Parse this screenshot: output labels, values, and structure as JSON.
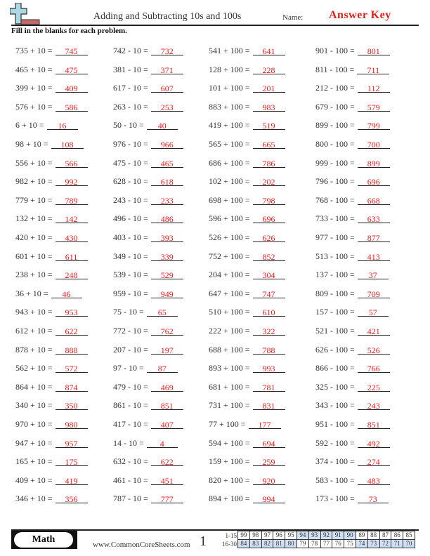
{
  "header": {
    "title": "Adding and Subtracting 10s and 100s",
    "name_label": "Name:",
    "answer_key": "Answer Key",
    "logo_icon": "plus-minus-icon"
  },
  "instructions": "Fill in the blanks for each problem.",
  "columns": [
    {
      "problems": [
        {
          "q": "735 + 10 =",
          "a": "745"
        },
        {
          "q": "465 + 10 =",
          "a": "475"
        },
        {
          "q": "399 + 10 =",
          "a": "409"
        },
        {
          "q": "576 + 10 =",
          "a": "586"
        },
        {
          "q": "6 + 10 =",
          "a": "16"
        },
        {
          "q": "98 + 10 =",
          "a": "108"
        },
        {
          "q": "556 + 10 =",
          "a": "566"
        },
        {
          "q": "982 + 10 =",
          "a": "992"
        },
        {
          "q": "779 + 10 =",
          "a": "789"
        },
        {
          "q": "132 + 10 =",
          "a": "142"
        },
        {
          "q": "420 + 10 =",
          "a": "430"
        },
        {
          "q": "601 + 10 =",
          "a": "611"
        },
        {
          "q": "238 + 10 =",
          "a": "248"
        },
        {
          "q": "36 + 10 =",
          "a": "46"
        },
        {
          "q": "943 + 10 =",
          "a": "953"
        },
        {
          "q": "612 + 10 =",
          "a": "622"
        },
        {
          "q": "878 + 10 =",
          "a": "888"
        },
        {
          "q": "562 + 10 =",
          "a": "572"
        },
        {
          "q": "864 + 10 =",
          "a": "874"
        },
        {
          "q": "340 + 10 =",
          "a": "350"
        },
        {
          "q": "970 + 10 =",
          "a": "980"
        },
        {
          "q": "947 + 10 =",
          "a": "957"
        },
        {
          "q": "165 + 10 =",
          "a": "175"
        },
        {
          "q": "409 + 10 =",
          "a": "419"
        },
        {
          "q": "346 + 10 =",
          "a": "356"
        }
      ]
    },
    {
      "problems": [
        {
          "q": "742 - 10 =",
          "a": "732"
        },
        {
          "q": "381 - 10 =",
          "a": "371"
        },
        {
          "q": "617 - 10 =",
          "a": "607"
        },
        {
          "q": "263 - 10 =",
          "a": "253"
        },
        {
          "q": "50 - 10 =",
          "a": "40"
        },
        {
          "q": "976 - 10 =",
          "a": "966"
        },
        {
          "q": "475 - 10 =",
          "a": "465"
        },
        {
          "q": "628 - 10 =",
          "a": "618"
        },
        {
          "q": "243 - 10 =",
          "a": "233"
        },
        {
          "q": "496 - 10 =",
          "a": "486"
        },
        {
          "q": "403 - 10 =",
          "a": "393"
        },
        {
          "q": "349 - 10 =",
          "a": "339"
        },
        {
          "q": "539 - 10 =",
          "a": "529"
        },
        {
          "q": "959 - 10 =",
          "a": "949"
        },
        {
          "q": "75 - 10 =",
          "a": "65"
        },
        {
          "q": "772 - 10 =",
          "a": "762"
        },
        {
          "q": "207 - 10 =",
          "a": "197"
        },
        {
          "q": "97 - 10 =",
          "a": "87"
        },
        {
          "q": "479 - 10 =",
          "a": "469"
        },
        {
          "q": "861 - 10 =",
          "a": "851"
        },
        {
          "q": "417 - 10 =",
          "a": "407"
        },
        {
          "q": "14 - 10 =",
          "a": "4"
        },
        {
          "q": "632 - 10 =",
          "a": "622"
        },
        {
          "q": "461 - 10 =",
          "a": "451"
        },
        {
          "q": "787 - 10 =",
          "a": "777"
        }
      ]
    },
    {
      "problems": [
        {
          "q": "541 + 100 =",
          "a": "641"
        },
        {
          "q": "128 + 100 =",
          "a": "228"
        },
        {
          "q": "101 + 100 =",
          "a": "201"
        },
        {
          "q": "883 + 100 =",
          "a": "983"
        },
        {
          "q": "419 + 100 =",
          "a": "519"
        },
        {
          "q": "565 + 100 =",
          "a": "665"
        },
        {
          "q": "686 + 100 =",
          "a": "786"
        },
        {
          "q": "102 + 100 =",
          "a": "202"
        },
        {
          "q": "698 + 100 =",
          "a": "798"
        },
        {
          "q": "596 + 100 =",
          "a": "696"
        },
        {
          "q": "526 + 100 =",
          "a": "626"
        },
        {
          "q": "752 + 100 =",
          "a": "852"
        },
        {
          "q": "204 + 100 =",
          "a": "304"
        },
        {
          "q": "647 + 100 =",
          "a": "747"
        },
        {
          "q": "510 + 100 =",
          "a": "610"
        },
        {
          "q": "222 + 100 =",
          "a": "322"
        },
        {
          "q": "688 + 100 =",
          "a": "788"
        },
        {
          "q": "893 + 100 =",
          "a": "993"
        },
        {
          "q": "681 + 100 =",
          "a": "781"
        },
        {
          "q": "731 + 100 =",
          "a": "831"
        },
        {
          "q": "77 + 100 =",
          "a": "177"
        },
        {
          "q": "594 + 100 =",
          "a": "694"
        },
        {
          "q": "159 + 100 =",
          "a": "259"
        },
        {
          "q": "820 + 100 =",
          "a": "920"
        },
        {
          "q": "894 + 100 =",
          "a": "994"
        }
      ]
    },
    {
      "problems": [
        {
          "q": "901 - 100 =",
          "a": "801"
        },
        {
          "q": "811 - 100 =",
          "a": "711"
        },
        {
          "q": "212 - 100 =",
          "a": "112"
        },
        {
          "q": "679 - 100 =",
          "a": "579"
        },
        {
          "q": "899 - 100 =",
          "a": "799"
        },
        {
          "q": "800 - 100 =",
          "a": "700"
        },
        {
          "q": "999 - 100 =",
          "a": "899"
        },
        {
          "q": "796 - 100 =",
          "a": "696"
        },
        {
          "q": "768 - 100 =",
          "a": "668"
        },
        {
          "q": "733 - 100 =",
          "a": "633"
        },
        {
          "q": "977 - 100 =",
          "a": "877"
        },
        {
          "q": "513 - 100 =",
          "a": "413"
        },
        {
          "q": "137 - 100 =",
          "a": "37"
        },
        {
          "q": "809 - 100 =",
          "a": "709"
        },
        {
          "q": "157 - 100 =",
          "a": "57"
        },
        {
          "q": "521 - 100 =",
          "a": "421"
        },
        {
          "q": "626 - 100 =",
          "a": "526"
        },
        {
          "q": "866 - 100 =",
          "a": "766"
        },
        {
          "q": "325 - 100 =",
          "a": "225"
        },
        {
          "q": "343 - 100 =",
          "a": "243"
        },
        {
          "q": "951 - 100 =",
          "a": "851"
        },
        {
          "q": "592 - 100 =",
          "a": "492"
        },
        {
          "q": "374 - 100 =",
          "a": "274"
        },
        {
          "q": "583 - 100 =",
          "a": "483"
        },
        {
          "q": "173 - 100 =",
          "a": "73"
        }
      ]
    }
  ],
  "footer": {
    "subject": "Math",
    "site": "www.CommonCoreSheets.com",
    "page_number": "1",
    "score_rows": [
      {
        "label": "1-15",
        "scores": [
          "99",
          "98",
          "97",
          "96",
          "95",
          "94",
          "93",
          "92",
          "91",
          "90",
          "89",
          "88",
          "87",
          "86",
          "85"
        ],
        "highlight": [
          false,
          false,
          false,
          false,
          false,
          true,
          true,
          true,
          true,
          true,
          false,
          false,
          false,
          false,
          false
        ]
      },
      {
        "label": "16-30",
        "scores": [
          "84",
          "83",
          "82",
          "81",
          "80",
          "79",
          "78",
          "77",
          "76",
          "75",
          "74",
          "73",
          "72",
          "71",
          "70"
        ],
        "highlight": [
          true,
          true,
          true,
          true,
          true,
          false,
          false,
          false,
          false,
          false,
          true,
          true,
          true,
          true,
          true
        ]
      }
    ],
    "highlight_color": "#cfe0f5"
  },
  "colors": {
    "answer": "#e8191c",
    "answer_key": "#e0201c"
  }
}
